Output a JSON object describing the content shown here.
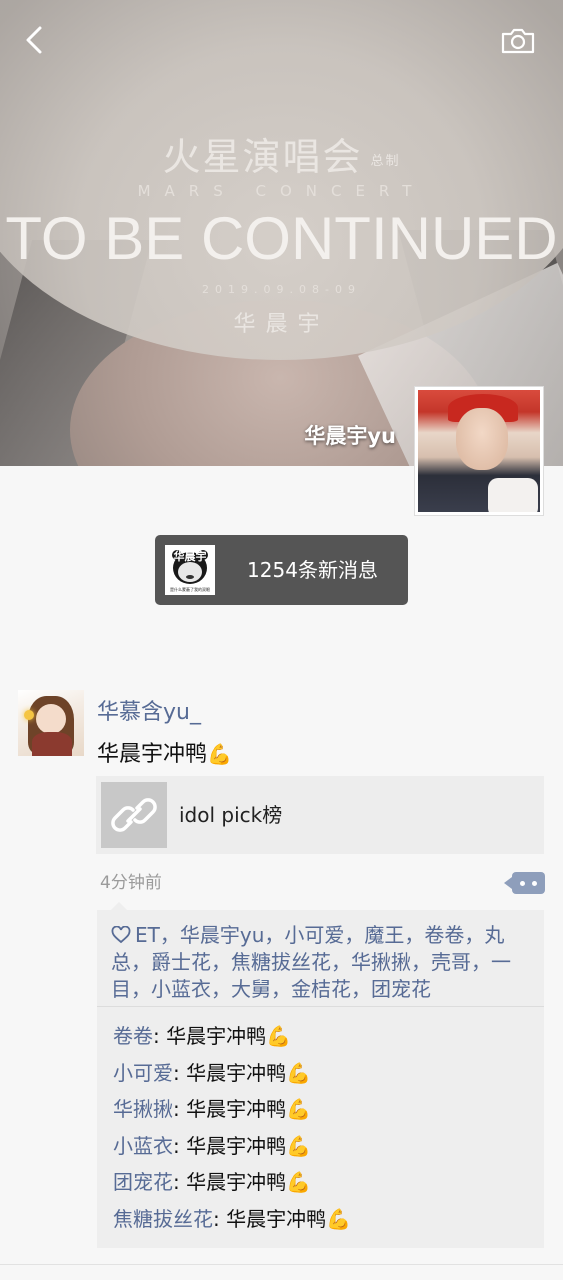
{
  "cover": {
    "title_cn": "火星演唱会",
    "title_cn_small": "总制",
    "subtitle_en": "MARS CONCERT",
    "headline": "TO BE CONTINUED",
    "date": "2019.09.08-09",
    "artist": "华晨宇"
  },
  "profile": {
    "name": "华晨宇yu"
  },
  "header": {
    "back_icon": "chevron-left-icon",
    "camera_icon": "camera-icon"
  },
  "notification": {
    "text": "1254条新消息",
    "thumb_label": "华晨宇",
    "thumb_sub": "是什么蒙蔽了我的双眼"
  },
  "post": {
    "author": "华慕含yu_",
    "text": "华晨宇冲鸭",
    "emoji": "💪",
    "link_title": "idol pick榜",
    "link_icon": "link-icon",
    "time": "4分钟前",
    "likes": "ET，华晨宇yu，小可爱，魔王，卷卷，丸总，爵士花，焦糖拔丝花，华揪揪，壳哥，一目，小蓝衣，大舅，金桔花，团宠花",
    "comments": [
      {
        "user": "卷卷",
        "text": ": 华晨宇冲鸭",
        "emoji": "💪"
      },
      {
        "user": "小可爱",
        "text": ": 华晨宇冲鸭",
        "emoji": "💪"
      },
      {
        "user": "华揪揪",
        "text": ": 华晨宇冲鸭",
        "emoji": "💪"
      },
      {
        "user": "小蓝衣",
        "text": ": 华晨宇冲鸭",
        "emoji": "💪"
      },
      {
        "user": "团宠花",
        "text": ": 华晨宇冲鸭",
        "emoji": "💪"
      },
      {
        "user": "焦糖拔丝花",
        "text": ": 华晨宇冲鸭",
        "emoji": "💪"
      }
    ]
  },
  "colors": {
    "link_blue": "#576b95",
    "notif_bg": "#555555",
    "page_bg": "#f7f7f7"
  }
}
